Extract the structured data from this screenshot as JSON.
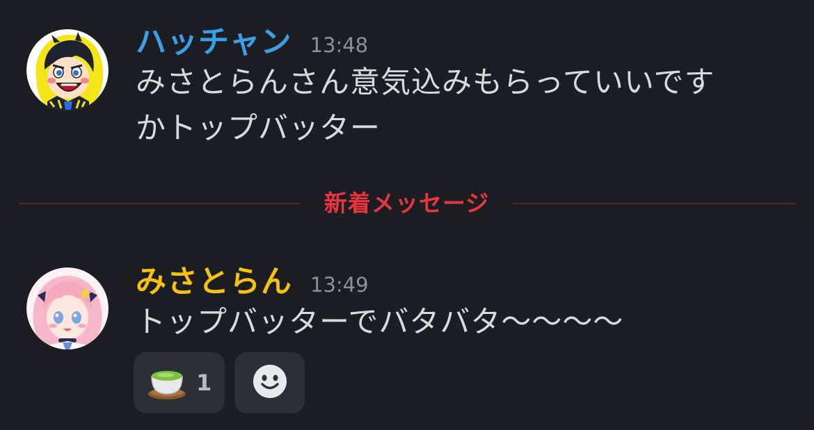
{
  "messages": [
    {
      "username": "ハッチャン",
      "time": "13:48",
      "text_lines": [
        "みさとらんさん意気込みもらっていいです",
        "かトップバッター"
      ],
      "avatar_icon": "hacchan-avatar-icon",
      "name_color": "#3aa0e6"
    },
    {
      "username": "みさとらん",
      "time": "13:49",
      "text_lines": [
        "トップバッターでバタバタ〜〜〜〜"
      ],
      "avatar_icon": "misatoran-avatar-icon",
      "name_color": "#f5c211",
      "reactions": [
        {
          "icon": "tea-cup-icon",
          "count": "1"
        }
      ],
      "add_reaction_icon": "smiley-icon"
    }
  ],
  "divider": {
    "label": "新着メッセージ",
    "color": "#e8353f"
  }
}
